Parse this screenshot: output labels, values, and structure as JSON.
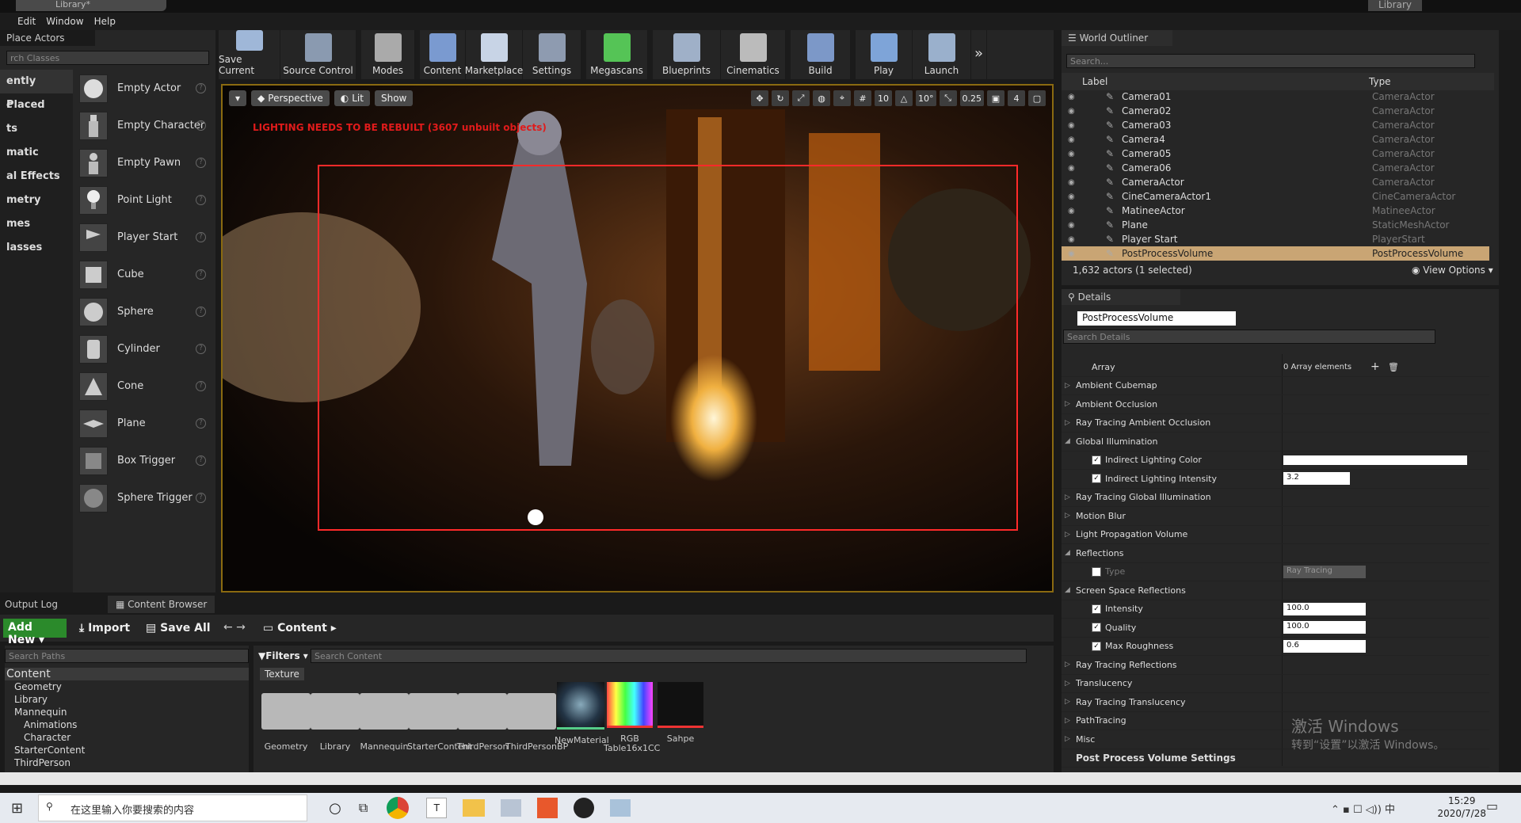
{
  "window": {
    "title_tab": "Library*",
    "title_right": "Library"
  },
  "menu": [
    "Edit",
    "Window",
    "Help"
  ],
  "place_actors": {
    "tab": "Place Actors",
    "search_placeholder": "rch Classes",
    "categories": [
      "ently Placed",
      "c",
      "ts",
      "matic",
      "al Effects",
      "metry",
      "mes",
      "lasses"
    ],
    "items": [
      "Empty Actor",
      "Empty Character",
      "Empty Pawn",
      "Point Light",
      "Player Start",
      "Cube",
      "Sphere",
      "Cylinder",
      "Cone",
      "Plane",
      "Box Trigger",
      "Sphere Trigger"
    ]
  },
  "toolbar": {
    "buttons": [
      "Save Current",
      "Source Control",
      "Modes",
      "Content",
      "Marketplace",
      "Settings",
      "Megascans",
      "Blueprints",
      "Cinematics",
      "Build",
      "Play",
      "Launch"
    ]
  },
  "viewport": {
    "perspective": "Perspective",
    "lit": "Lit",
    "show": "Show",
    "grid_snap": "10",
    "rot_snap": "10°",
    "scale_snap": "0.25",
    "cam_speed": "4",
    "warning": "LIGHTING NEEDS TO BE REBUILT (3607 unbuilt objects)"
  },
  "outliner": {
    "tab": "World Outliner",
    "search_placeholder": "Search...",
    "col_label": "Label",
    "col_type": "Type",
    "rows": [
      {
        "label": "Camera01",
        "type": "CameraActor"
      },
      {
        "label": "Camera02",
        "type": "CameraActor"
      },
      {
        "label": "Camera03",
        "type": "CameraActor"
      },
      {
        "label": "Camera4",
        "type": "CameraActor"
      },
      {
        "label": "Camera05",
        "type": "CameraActor"
      },
      {
        "label": "Camera06",
        "type": "CameraActor"
      },
      {
        "label": "CameraActor",
        "type": "CameraActor"
      },
      {
        "label": "CineCameraActor1",
        "type": "CineCameraActor"
      },
      {
        "label": "MatineeActor",
        "type": "MatineeActor"
      },
      {
        "label": "Plane",
        "type": "StaticMeshActor"
      },
      {
        "label": "Player Start",
        "type": "PlayerStart"
      },
      {
        "label": "PostProcessVolume",
        "type": "PostProcessVolume"
      }
    ],
    "count": "1,632 actors (1 selected)",
    "view_options": "View Options"
  },
  "details": {
    "tab": "Details",
    "object_name": "PostProcessVolume",
    "search_placeholder": "Search Details",
    "props": [
      {
        "label": "Array",
        "value": "0 Array elements"
      },
      {
        "label": "Ambient Cubemap"
      },
      {
        "label": "Ambient Occlusion"
      },
      {
        "label": "Ray Tracing Ambient Occlusion"
      },
      {
        "label": "Global Illumination"
      },
      {
        "label": "Indirect Lighting Color"
      },
      {
        "label": "Indirect Lighting Intensity",
        "value": "3.2"
      },
      {
        "label": "Ray Tracing Global Illumination"
      },
      {
        "label": "Motion Blur"
      },
      {
        "label": "Light Propagation Volume"
      },
      {
        "label": "Reflections"
      },
      {
        "label": "Type",
        "value": "Ray Tracing"
      },
      {
        "label": "Screen Space Reflections"
      },
      {
        "label": "Intensity",
        "value": "100.0"
      },
      {
        "label": "Quality",
        "value": "100.0"
      },
      {
        "label": "Max Roughness",
        "value": "0.6"
      },
      {
        "label": "Ray Tracing Reflections"
      },
      {
        "label": "Translucency"
      },
      {
        "label": "Ray Tracing Translucency"
      },
      {
        "label": "PathTracing"
      },
      {
        "label": "Misc"
      },
      {
        "label": "Post Process Volume Settings"
      }
    ]
  },
  "content_browser": {
    "tab_log": "Output Log",
    "tab_cb": "Content Browser",
    "add_new": "Add New",
    "import": "Import",
    "save_all": "Save All",
    "breadcrumb": "Content",
    "search_paths": "Search Paths",
    "filters": "Filters",
    "search_content": "Search Content",
    "filter_chip": "Texture",
    "tree": [
      "Content",
      "Geometry",
      "Library",
      "Mannequin",
      "Animations",
      "Character",
      "StarterContent",
      "ThirdPerson"
    ],
    "assets": [
      "Geometry",
      "Library",
      "Mannequin",
      "StarterContent",
      "ThirdPerson",
      "ThirdPersonBP",
      "NewMaterial",
      "RGB Table16x1CC",
      "Sahpe"
    ]
  },
  "watermark": {
    "line1": "激活 Windows",
    "line2": "转到“设置”以激活 Windows。"
  },
  "taskbar": {
    "search": "在这里输入你要搜索的内容",
    "time": "15:29",
    "date": "2020/7/28",
    "ime": "中"
  }
}
